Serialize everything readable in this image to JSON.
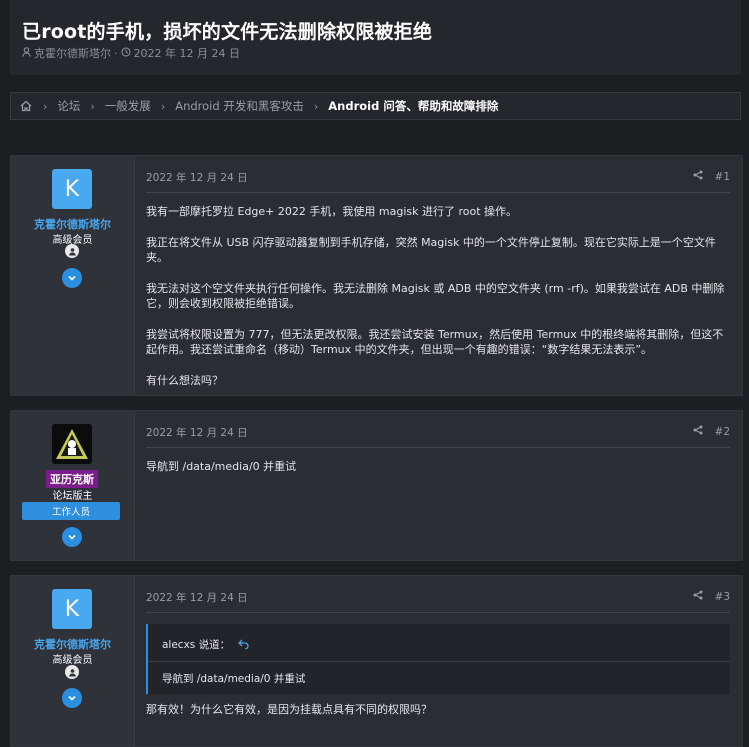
{
  "thread": {
    "title": "已root的手机，损坏的文件无法删除权限被拒绝",
    "author": "克霍尔德斯塔尔",
    "separator": "·",
    "date": "2022 年 12 月 24 日"
  },
  "breadcrumb": {
    "items": [
      "论坛",
      "一般发展",
      "Android 开发和黑客攻击"
    ],
    "current": "Android 问答、帮助和故障排除"
  },
  "posts": [
    {
      "avatar_letter": "K",
      "username": "克霍尔德斯塔尔",
      "user_title": "高级会员",
      "date": "2022 年 12 月 24 日",
      "number": "#1",
      "paragraphs": [
        "我有一部摩托罗拉 Edge+ 2022 手机，我使用 magisk 进行了 root 操作。",
        "我正在将文件从 USB 闪存驱动器复制到手机存储，突然 Magisk 中的一个文件停止复制。现在它实际上是一个空文件夹。",
        "我无法对这个空文件夹执行任何操作。我无法删除 Magisk 或 ADB 中的空文件夹 (rm -rf)。如果我尝试在 ADB 中删除它，则会收到权限被拒绝错误。",
        "我尝试将权限设置为 777，但无法更改权限。我还尝试安装 Termux，然后使用 Termux 中的根终端将其删除，但这不起作用。我还尝试重命名（移动）Termux 中的文件夹，但出现一个有趣的错误：“数字结果无法表示”。",
        "有什么想法吗？"
      ]
    },
    {
      "username": "亚历克斯",
      "user_title": "论坛版主",
      "staff_label": "工作人员",
      "date": "2022 年 12 月 24 日",
      "number": "#2",
      "paragraphs": [
        "导航到 /data/media/0 并重试"
      ]
    },
    {
      "avatar_letter": "K",
      "username": "克霍尔德斯塔尔",
      "user_title": "高级会员",
      "date": "2022 年 12 月 24 日",
      "number": "#3",
      "quote": {
        "author_line": "alecxs 说道：",
        "text": "导航到 /data/media/0 并重试"
      },
      "paragraphs": [
        "那有效！为什么它有效，是因为挂载点具有不同的权限吗？"
      ]
    }
  ],
  "colors": {
    "accent": "#2a8fe0",
    "username": "#4aa4e8",
    "moderator_bg": "#7b1d8a",
    "background": "#1d1e22"
  },
  "icons": {
    "user": "user-icon",
    "clock": "clock-icon",
    "home": "home-icon",
    "share": "share-icon",
    "expand": "chevron-down-icon",
    "jump": "jump-to-quote-icon"
  }
}
